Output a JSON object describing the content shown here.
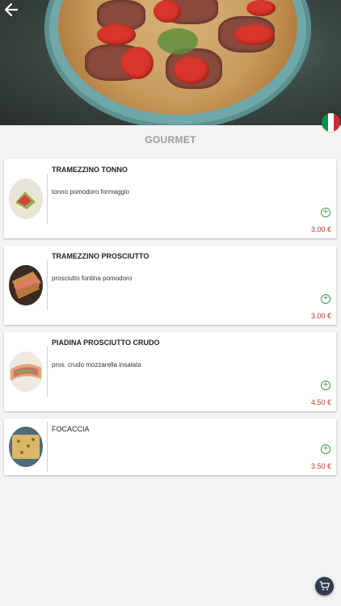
{
  "header": {
    "back_icon": "arrow-left-icon",
    "flag_colors": [
      "#009246",
      "#ffffff",
      "#ce2b37"
    ]
  },
  "section": {
    "title": "GOURMET"
  },
  "products": [
    {
      "name": "TRAMEZZINO TONNO",
      "description": "tonno pomodoro formaggio",
      "price": "3.00 €"
    },
    {
      "name": "TRAMEZZINO PROSCIUTTO",
      "description": "prosciutto fontina pomodoro",
      "price": "3.00 €"
    },
    {
      "name": "PIADINA PROSCIUTTO CRUDO",
      "description": "pros. crudo mozzarella insalata",
      "price": "4.50 €"
    },
    {
      "name": "FOCACCIA",
      "description": "",
      "price": "3.50 €"
    }
  ],
  "cart": {
    "icon": "cart-icon"
  },
  "colors": {
    "add": "#3e9a3e",
    "price": "#c0392b",
    "cart_bg": "#2f3e4e"
  }
}
